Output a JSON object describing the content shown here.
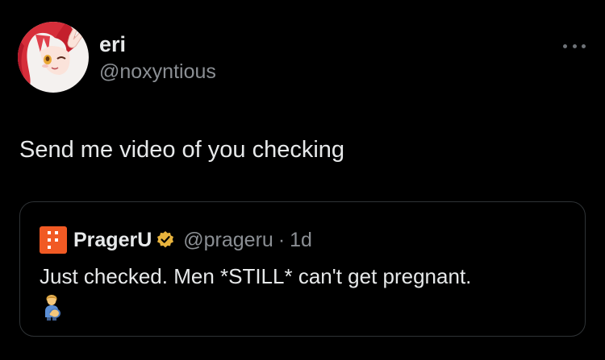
{
  "tweet": {
    "author": {
      "display_name": "eri",
      "handle": "@noxyntious"
    },
    "text": "Send me video of you checking",
    "more_icon": "more-horizontal-icon",
    "quoted": {
      "display_name": "PragerU",
      "handle": "@prageru",
      "separator": "·",
      "time": "1d",
      "text": "Just checked. Men *STILL* can't get pregnant.",
      "emoji": "pregnant-man-emoji",
      "verified_icon": "verified-badge-icon",
      "avatar_color": "#f15a24",
      "verified_color": "#e8b33d"
    }
  },
  "colors": {
    "background": "#000000",
    "primary_text": "#e7e9ea",
    "secondary_text": "#8b8f94",
    "border": "#2f3336"
  }
}
